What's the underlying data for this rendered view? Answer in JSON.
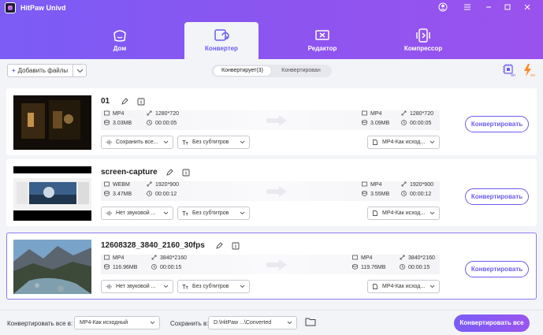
{
  "app": {
    "title": "HitPaw Univd",
    "accent": "#6b5cf0"
  },
  "nav": {
    "tabs": [
      {
        "label": "Дом",
        "icon": "home-icon"
      },
      {
        "label": "Конвертер",
        "icon": "converter-icon",
        "active": true
      },
      {
        "label": "Редактор",
        "icon": "editor-icon"
      },
      {
        "label": "Компрессор",
        "icon": "compressor-icon"
      }
    ]
  },
  "toolbar": {
    "add_files_label": "Добавить файлы",
    "segments": [
      {
        "label": "Конвертирует(3)",
        "active": true
      },
      {
        "label": "Конвертирован",
        "active": false
      }
    ]
  },
  "files": [
    {
      "name": "01",
      "src": {
        "format": "MP4",
        "resolution": "1280*720",
        "size": "3.03MB",
        "duration": "00:00:05"
      },
      "dst": {
        "format": "MP4",
        "resolution": "1280*720",
        "size": "3.09MB",
        "duration": "00:00:05"
      },
      "audio": "Сохранить все...",
      "subtitle": "Без субтитров",
      "output": "MP4-Как исход...",
      "button": "Конвертировать",
      "selected": false
    },
    {
      "name": "screen-capture",
      "src": {
        "format": "WEBM",
        "resolution": "1920*900",
        "size": "3.47MB",
        "duration": "00:00:12"
      },
      "dst": {
        "format": "MP4",
        "resolution": "1920*900",
        "size": "3.55MB",
        "duration": "00:00:12"
      },
      "audio": "Нет звуковой ...",
      "subtitle": "Без субтитров",
      "output": "MP4-Как исход...",
      "button": "Конвертировать",
      "selected": false
    },
    {
      "name": "12608328_3840_2160_30fps",
      "src": {
        "format": "MP4",
        "resolution": "3840*2160",
        "size": "116.96MB",
        "duration": "00:00:15"
      },
      "dst": {
        "format": "MP4",
        "resolution": "3840*2160",
        "size": "119.76MB",
        "duration": "00:00:15"
      },
      "audio": "Нет звуковой ...",
      "subtitle": "Без субтитров",
      "output": "MP4-Как исход...",
      "button": "Конвертировать",
      "selected": true
    }
  ],
  "footer": {
    "convert_all_to_label": "Конвертировать все в:",
    "convert_all_to_value": "MP4-Как исходный",
    "save_to_label": "Сохранить в:",
    "save_to_value": "D:\\HitPaw ...\\Converted",
    "convert_all_button": "Конвертировать все"
  }
}
